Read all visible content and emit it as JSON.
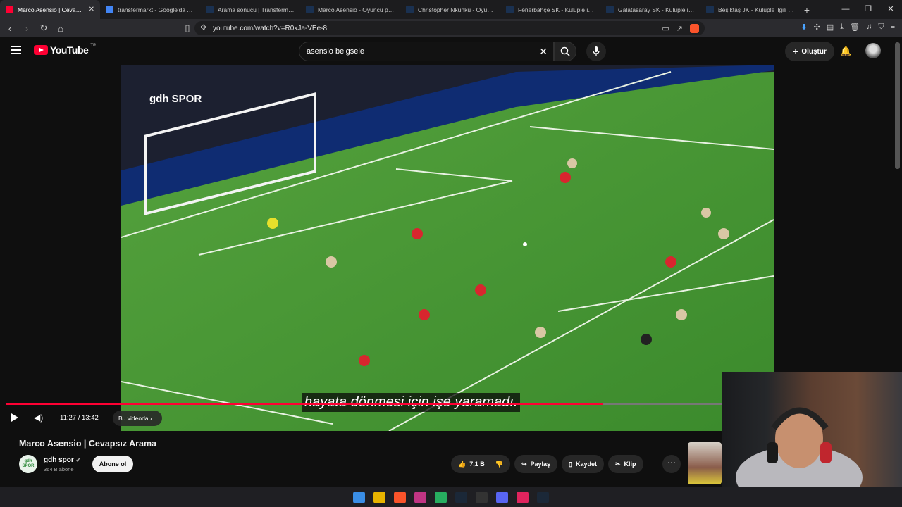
{
  "browser": {
    "tabs": [
      {
        "title": "Marco Asensio | Cevapsız Arama",
        "color": "#ff0033",
        "active": true
      },
      {
        "title": "transfermarkt - Google'da Ara",
        "color": "#4285f4"
      },
      {
        "title": "Arama sonucu | Transfermarkt",
        "color": "#1a3151"
      },
      {
        "title": "Marco Asensio - Oyuncu profili",
        "color": "#1a3151"
      },
      {
        "title": "Christopher Nkunku - Oyuncu",
        "color": "#1a3151"
      },
      {
        "title": "Fenerbahçe SK - Kulüple ilgili",
        "color": "#1a3151"
      },
      {
        "title": "Galatasaray SK - Kulüple ilgili",
        "color": "#1a3151"
      },
      {
        "title": "Beşiktaş JK - Kulüple ilgili tran",
        "color": "#1a3151"
      }
    ],
    "url": "youtube.com/watch?v=R0kJa-VEe-8"
  },
  "youtube": {
    "logo_text": "YouTube",
    "country": "TR",
    "search_value": "asensio belgsele",
    "create_label": "Oluştur"
  },
  "video": {
    "watermark": "gdh SPOR",
    "subtitle": "hayata dönmesi için işe yaramadı.",
    "time": "11:27 / 13:42",
    "progress": 0.835,
    "chapter_label": "Bu videoda",
    "title": "Marco Asensio | Cevapsız Arama"
  },
  "channel": {
    "avatar_text": "gdh SPOR",
    "name": "gdh spor",
    "subscribers": "364 B abone",
    "subscribe_label": "Abone ol"
  },
  "actions": {
    "likes": "7,1 B",
    "share": "Paylaş",
    "save": "Kaydet",
    "clip": "Klip"
  },
  "taskbar_colors": [
    "#3a8ee6",
    "#e8b400",
    "#fb542b",
    "#c13584",
    "#27ae60",
    "#1b2838",
    "#333",
    "#5865f2",
    "#e0245e",
    "#1b2838"
  ]
}
